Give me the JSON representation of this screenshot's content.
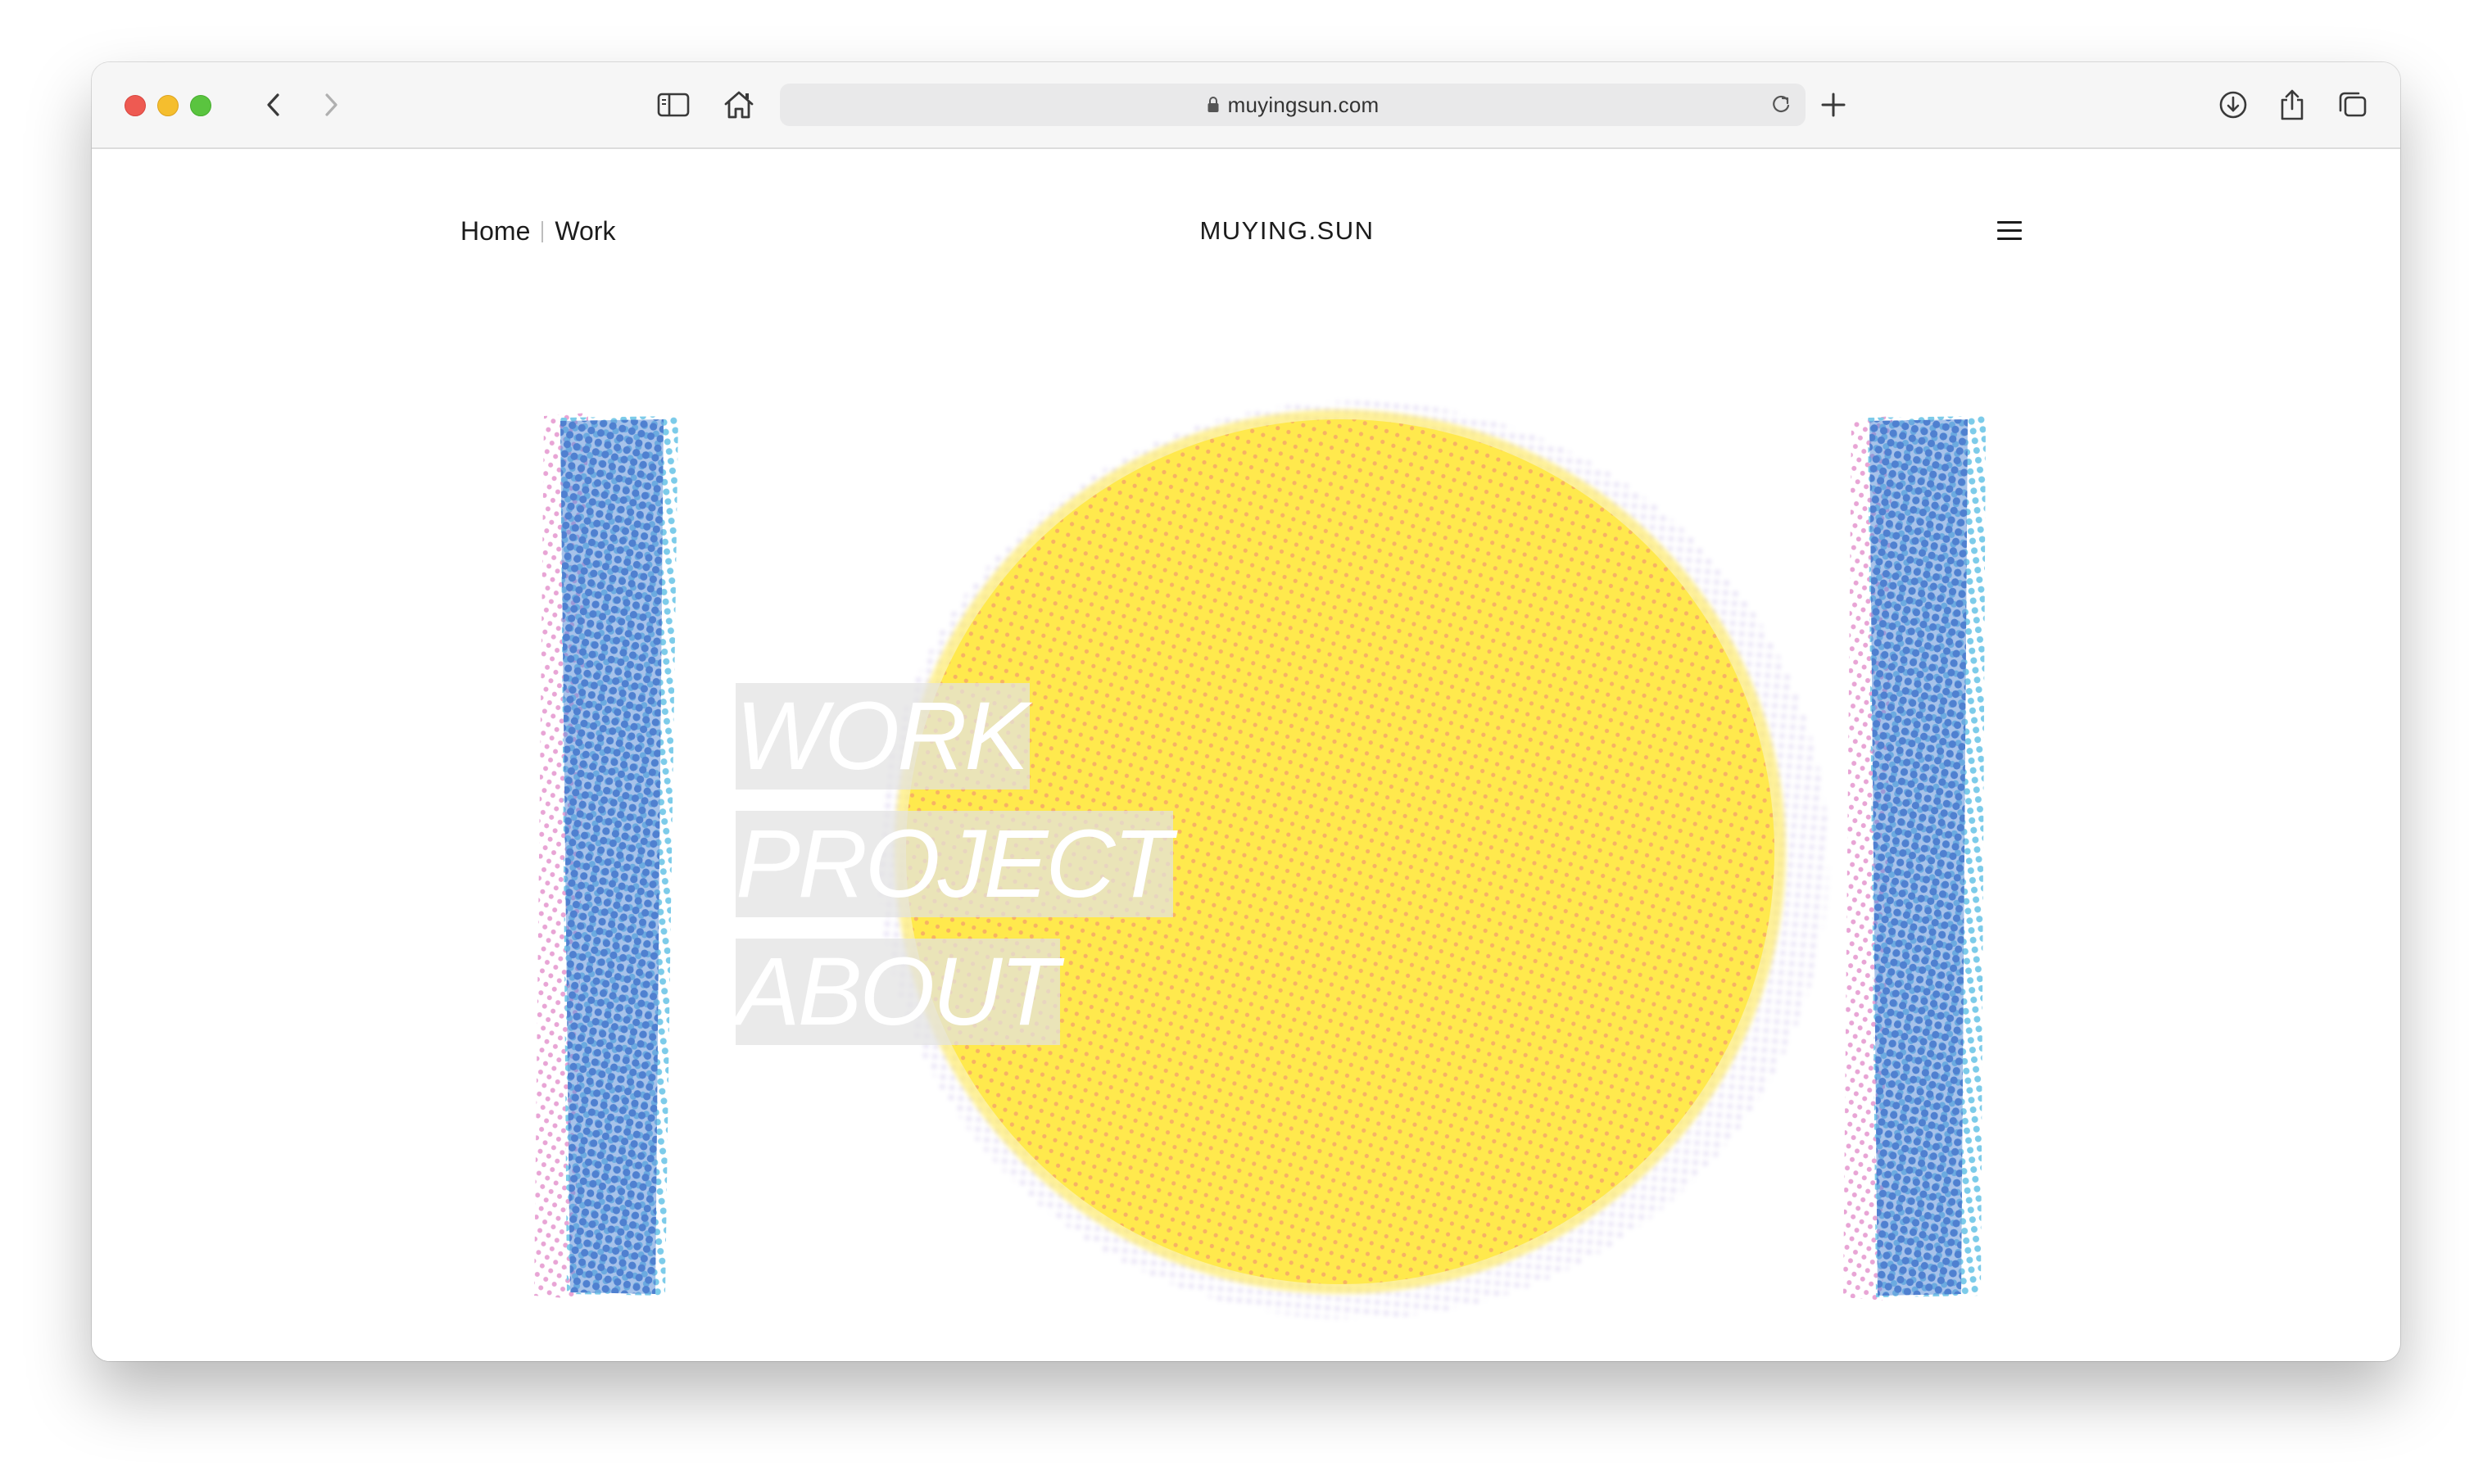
{
  "browser": {
    "url": "muyingsun.com",
    "icons": {
      "back": "chevron-left-icon",
      "forward": "chevron-right-icon",
      "sidebar": "sidebar-icon",
      "home": "home-icon",
      "lock": "lock-icon",
      "reload": "reload-icon",
      "new_tab": "plus-icon",
      "download": "download-icon",
      "share": "share-icon",
      "tabs": "tabs-overview-icon"
    }
  },
  "site": {
    "nav": {
      "home": "Home",
      "work": "Work"
    },
    "brand": "MUYING.SUN",
    "menu_icon": "hamburger-menu-icon",
    "hero_menu": {
      "work": "WORK",
      "project": "PROJECT",
      "about": "ABOUT"
    },
    "colors": {
      "circle": "#ffe84a",
      "circle_dot": "#f4a06a",
      "bar_blue": "#5d8fd8",
      "bar_cyan": "#79c9e8",
      "bar_pink": "#e394c9"
    }
  }
}
